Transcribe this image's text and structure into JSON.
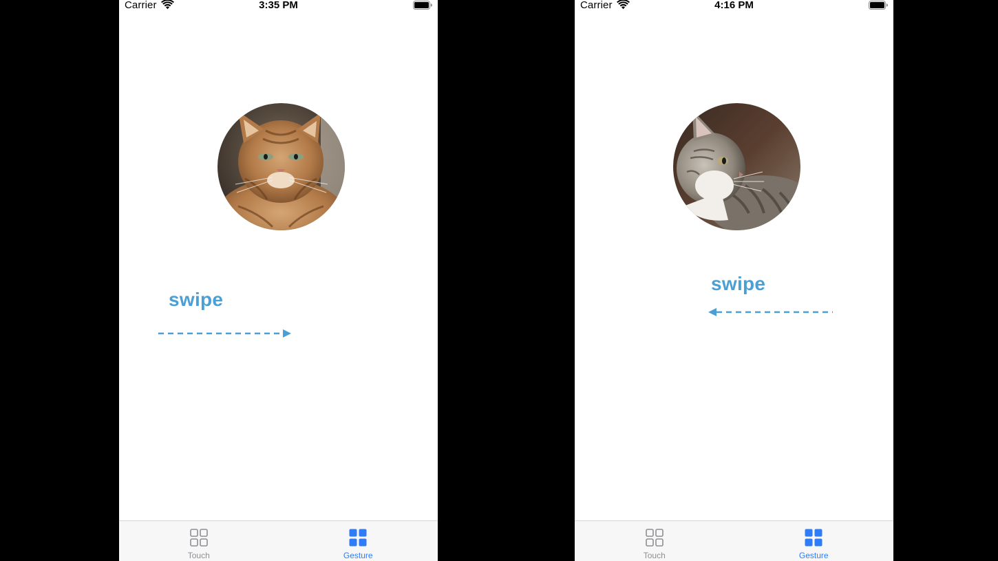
{
  "colors": {
    "accent": "#2f7cf6",
    "swipe": "#4a9fd4",
    "inactive": "#8e8e93",
    "background": "#000000"
  },
  "left_screen": {
    "status_bar": {
      "carrier": "Carrier",
      "time": "3:35 PM"
    },
    "image": "orange-tabby-cat",
    "gesture_label": "swipe",
    "swipe_direction": "right",
    "tabs": [
      {
        "label": "Touch",
        "icon": "grid-outline-icon",
        "selected": false
      },
      {
        "label": "Gesture",
        "icon": "grid-filled-icon",
        "selected": true
      }
    ]
  },
  "right_screen": {
    "status_bar": {
      "carrier": "Carrier",
      "time": "4:16 PM"
    },
    "image": "grey-tabby-kitten",
    "gesture_label": "swipe",
    "swipe_direction": "left",
    "tabs": [
      {
        "label": "Touch",
        "icon": "grid-outline-icon",
        "selected": false
      },
      {
        "label": "Gesture",
        "icon": "grid-filled-icon",
        "selected": true
      }
    ]
  }
}
